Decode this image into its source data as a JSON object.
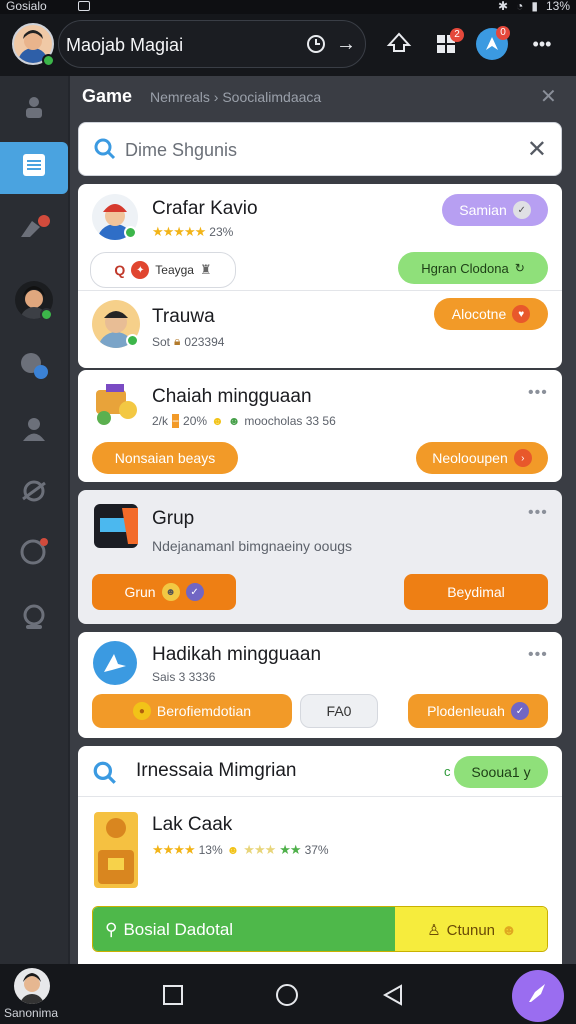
{
  "status_bar": {
    "title": "Gosialo",
    "battery": "13%"
  },
  "header": {
    "app_title": "Maojab Magiai",
    "badges": {
      "grid": "2",
      "compass": "0"
    }
  },
  "breadcrumb": {
    "root": "Game",
    "rest": "Nemreals › Soocialimdaaca"
  },
  "search": {
    "placeholder": "Dime Shgunis"
  },
  "cards": {
    "c1": {
      "title": "Crafar Kavio",
      "rating": "23%",
      "status": "Samian",
      "chip_label": "Teayga",
      "green_label": "Hgran Clodona"
    },
    "c2": {
      "title": "Trauwa",
      "meta_prefix": "Sot",
      "meta_value": "023394",
      "button": "Alocotne"
    },
    "c3": {
      "title": "Chaiah mingguaan",
      "meta1": "2/k",
      "meta2": "20%",
      "meta3": "moocholas 33 56",
      "button_left": "Nonsaian beays",
      "button_right": "Neolooupen"
    },
    "c4": {
      "title": "Grup",
      "description": "Ndejanamanl bimgnaeiny oougs",
      "button_left": "Grun",
      "button_right": "Beydimal"
    },
    "c5": {
      "title": "Hadikah mingguaan",
      "meta": "Sais 3 3336",
      "button_left": "Berofiemdotian",
      "button_mid": "FA0",
      "button_right": "Plodenleuah"
    },
    "c6": {
      "search_title": "Irnessaia Mimgrian",
      "search_pill": "Sooua1 y",
      "item_title": "Lak Caak",
      "rating1": "13%",
      "rating2": "37%",
      "bar_left": "Bosial Dadotal",
      "bar_right": "Ctunun"
    }
  },
  "sidebar": {
    "profile_label": "Sanonima"
  },
  "colors": {
    "accent_blue": "#4aa3e0",
    "orange": "#f29a28",
    "green": "#8fe07a",
    "purple": "#9a6df0",
    "red_badge": "#e5483b"
  }
}
